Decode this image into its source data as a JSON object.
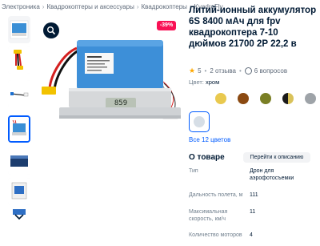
{
  "breadcrumb": [
    "Электроника",
    "Квадрокоптеры и аксессуары",
    "Квадрокоптеры",
    "KvadroFly"
  ],
  "breadcrumb_separator": "›",
  "product": {
    "title": "Литий-ионный аккумулятор 6S 8400 мАч для fpv квадрокоптера 7-10 дюймов 21700 2P 22,2 в",
    "discount_badge": "-39%",
    "rating": "5",
    "reviews": "2 отзыва",
    "questions": "6 вопросов",
    "scale_display": "859"
  },
  "colors": {
    "label": "Цвет:",
    "selected": "хром",
    "all_link": "Все 12 цветов",
    "swatches": [
      "#e9c94f",
      "#8b4a12",
      "#7a7f25",
      "#1a1a1a",
      "#9ea3a8",
      "#d6dee6"
    ]
  },
  "about": {
    "title": "О товаре",
    "button": "Перейти к описанию",
    "specs": [
      {
        "label": "Тип",
        "value": "Дрон для аэрофотосъемки"
      },
      {
        "label": "Дальность полета, м",
        "value": "111"
      },
      {
        "label": "Максимальная скорость, км/ч",
        "value": "11"
      },
      {
        "label": "Количество моторов",
        "value": "4"
      }
    ]
  },
  "accent_color": "#005bff",
  "discount_color": "#f91155"
}
